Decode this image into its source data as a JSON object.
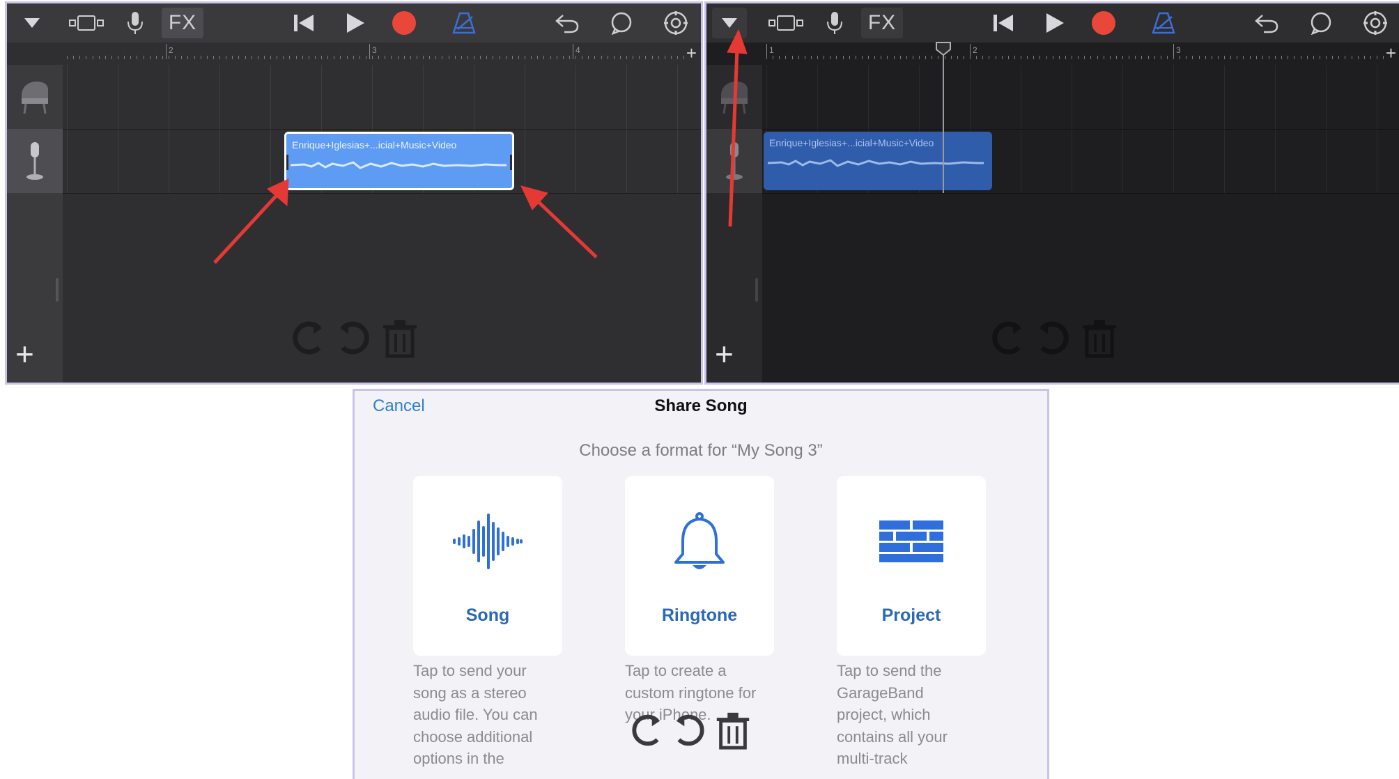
{
  "toolbar": {
    "fx_label": "FX",
    "icons": [
      "dropdown-arrow-icon",
      "tracks-view-icon",
      "microphone-icon",
      "fx",
      "skip-back-icon",
      "play-icon",
      "record-icon",
      "metronome-icon",
      "undo-icon",
      "loop-icon",
      "settings-icon"
    ]
  },
  "ruler_left": {
    "bar_numbers": [
      "2",
      "3",
      "4"
    ]
  },
  "ruler_right": {
    "bar_numbers": [
      "1",
      "2",
      "3"
    ]
  },
  "region": {
    "name": "Enrique+Iglesias+...icial+Music+Video"
  },
  "colors": {
    "region_selected": "#5d9cf2",
    "region_dim": "#2f5dab",
    "record": "#e8473a",
    "metronome": "#3b6fd8",
    "accent_link": "#2e7fd6",
    "annotation_arrow": "#e53935",
    "card_label": "#2a68b8"
  },
  "share": {
    "cancel_label": "Cancel",
    "title": "Share Song",
    "subtitle": "Choose a format for “My Song 3”",
    "options": [
      {
        "label": "Song",
        "icon": "waveform-icon",
        "desc_lines": [
          "Tap to send your",
          "song as a stereo",
          "audio file. You can",
          "choose additional",
          "options in the"
        ]
      },
      {
        "label": "Ringtone",
        "icon": "bell-icon",
        "desc_lines": [
          "Tap to create a",
          "custom ringtone for",
          "your iPhone."
        ]
      },
      {
        "label": "Project",
        "icon": "bricks-icon",
        "desc_lines": [
          "Tap to send the",
          "GarageBand",
          "project, which",
          "contains all your",
          "multi-track"
        ]
      }
    ]
  }
}
